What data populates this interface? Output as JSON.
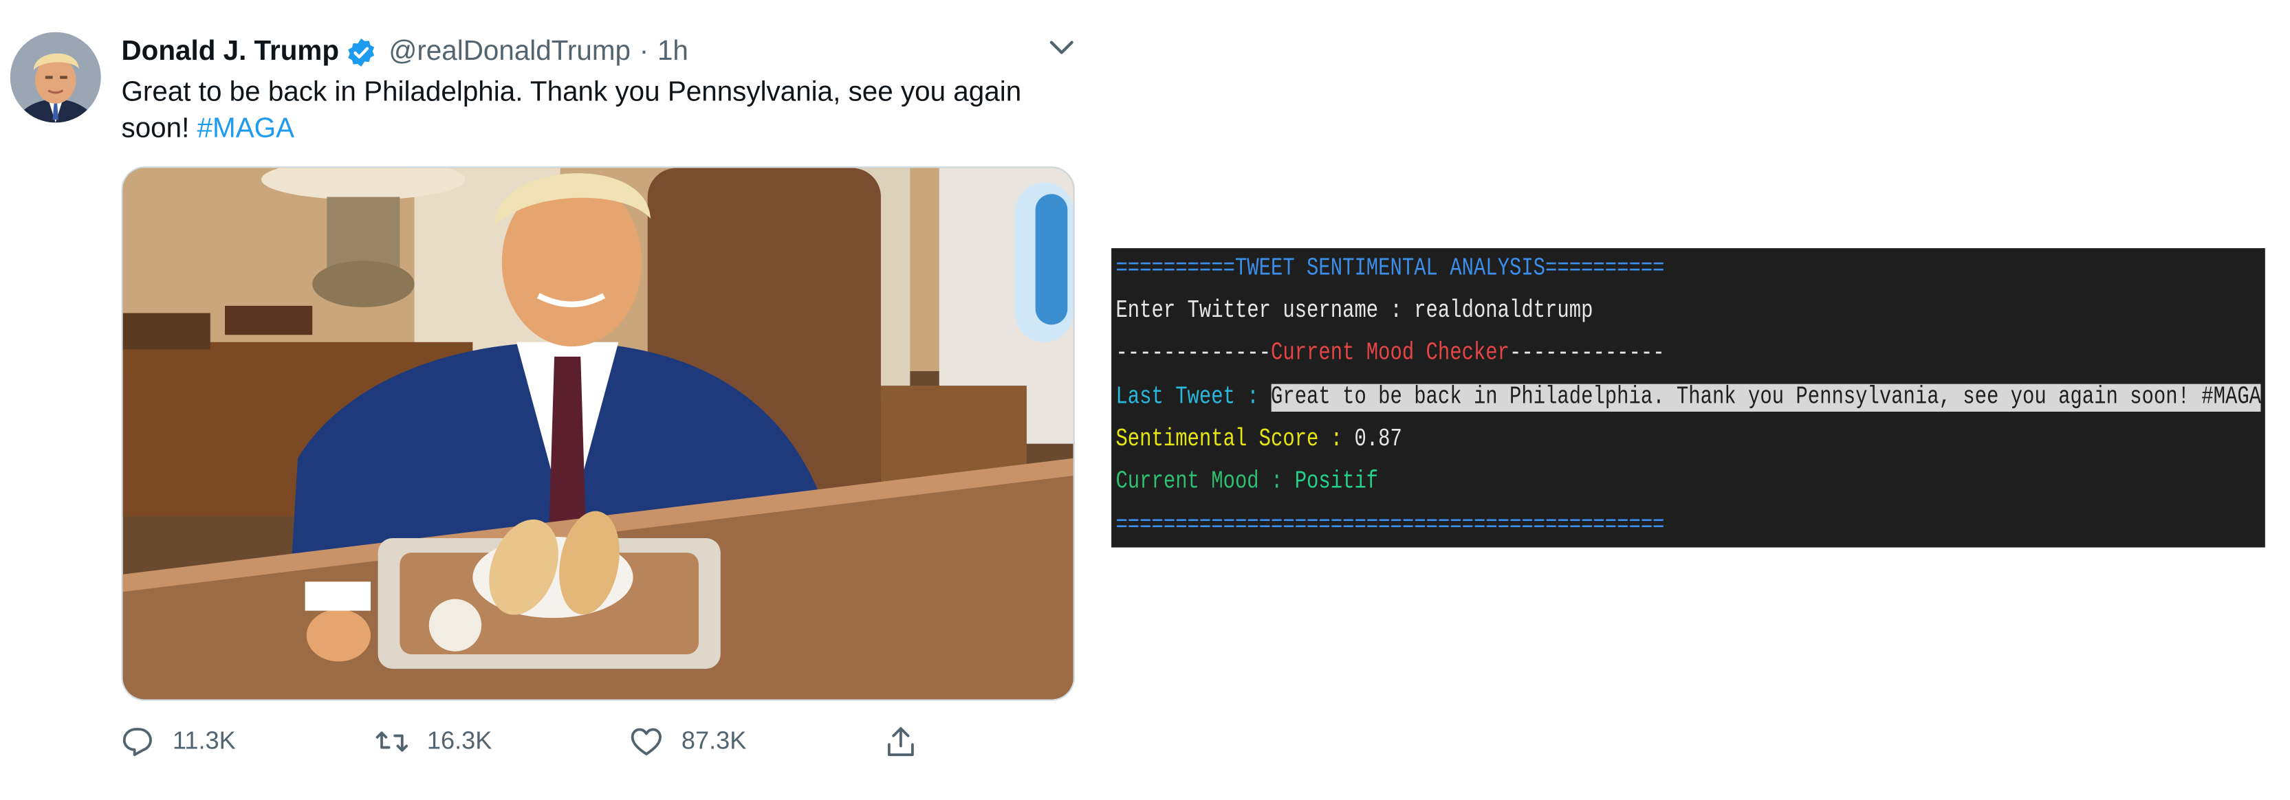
{
  "tweet": {
    "name": "Donald J. Trump",
    "handle": "@realDonaldTrump",
    "separator": "·",
    "time": "1h",
    "text": "Great to be back in Philadelphia. Thank you Pennsylvania, see you again soon! ",
    "hashtag": "#MAGA",
    "stats": {
      "replies": "11.3K",
      "retweets": "16.3K",
      "likes": "87.3K"
    }
  },
  "terminal": {
    "header": "==========TWEET SENTIMENTAL ANALYSIS==========",
    "username_prompt": "Enter Twitter username : realdonaldtrump",
    "checker_left": "-------------",
    "checker_title": "Current Mood Checker",
    "checker_right": "-------------",
    "last_tweet_label": "Last Tweet : ",
    "last_tweet_value": "Great to be back in Philadelphia. Thank you Pennsylvania, see you again soon! #MAGA",
    "score_label": "Sentimental Score : ",
    "score_value": "0.87",
    "mood_label": "Current Mood : ",
    "mood_value": "Positif",
    "footer": "=============================================="
  },
  "colors": {
    "terminal_bg": "#1e1e1e",
    "header": "#3b8eea",
    "checker_title": "#e54545",
    "last_tweet_label": "#29b8db",
    "score_label": "#e5e510",
    "mood": "#23d18b",
    "hashtag": "#1d9bf0"
  },
  "icons": {
    "verified": "verified-badge-icon",
    "more": "chevron-down-icon",
    "reply": "reply-icon",
    "retweet": "retweet-icon",
    "like": "heart-icon",
    "share": "share-icon"
  }
}
